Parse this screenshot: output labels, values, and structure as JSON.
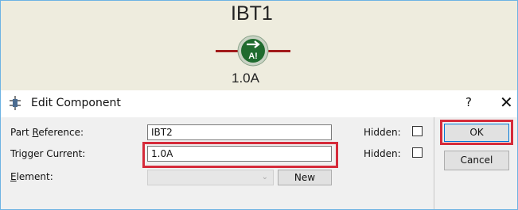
{
  "schematic": {
    "component_name": "IBT1",
    "component_value": "1.0A",
    "symbol_glyph": "A!",
    "symbol_icon": "current-breakpoint-arrow-icon",
    "wire_color": "#a21b1b",
    "symbol_color": "#1f6b2e"
  },
  "window": {
    "title": "Edit Component",
    "title_icon": "component-pins-icon",
    "help_label": "?",
    "close_label": "✕"
  },
  "form": {
    "part_reference": {
      "label_pre": "Part ",
      "label_key": "R",
      "label_post": "eference:",
      "value": "IBT2"
    },
    "trigger_current": {
      "label": "Trigger Current:",
      "value": "1.0A"
    },
    "element": {
      "label_key": "E",
      "label_post": "lement:",
      "value": ""
    },
    "new_button": "New",
    "hidden_label": "Hidden:"
  },
  "buttons": {
    "ok": "OK",
    "cancel": "Cancel"
  },
  "highlight_color": "#d52b3a"
}
